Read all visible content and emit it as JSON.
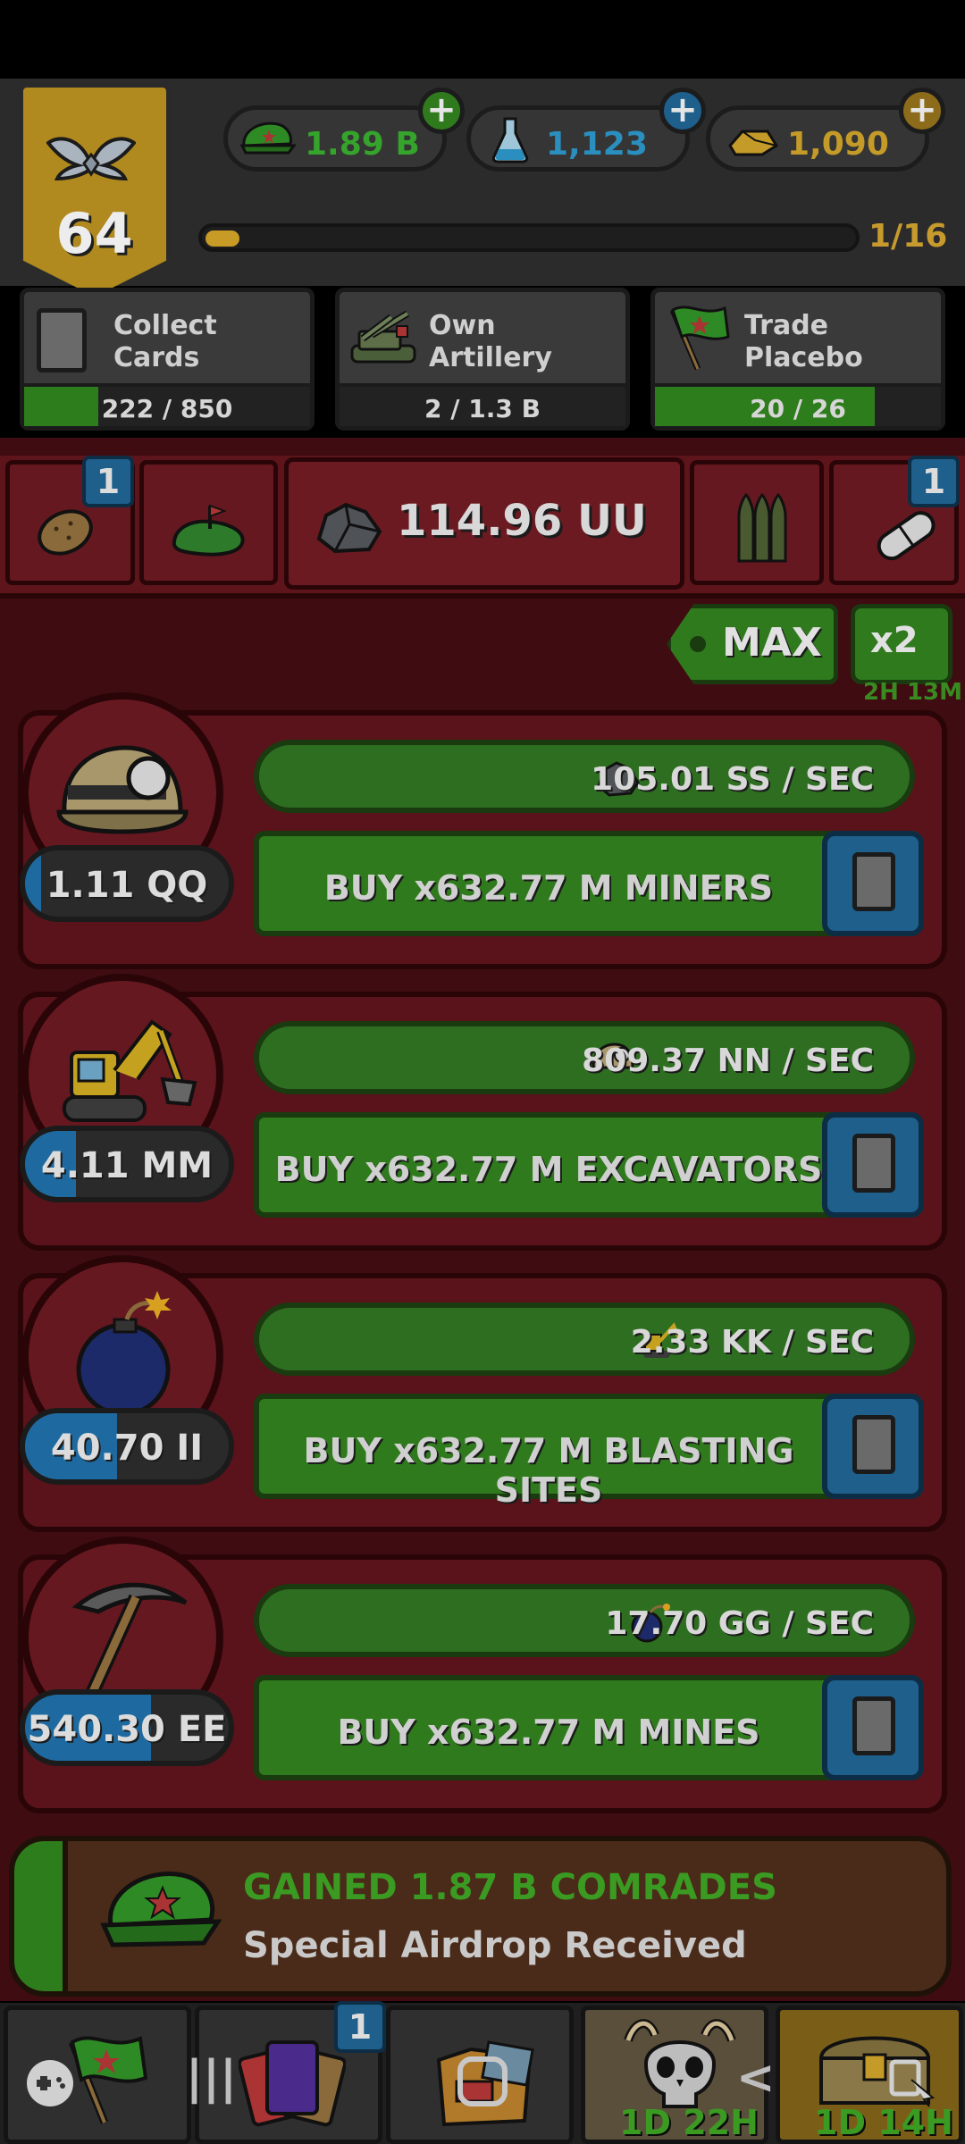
{
  "header": {
    "level": "64",
    "currencies": [
      {
        "name": "comrades",
        "icon": "green-cap-icon",
        "value": "1.89 B",
        "color": "#35a32c"
      },
      {
        "name": "science",
        "icon": "flask-icon",
        "value": "1,123",
        "color": "#2a8fbf"
      },
      {
        "name": "gold",
        "icon": "gold-bars-icon",
        "value": "1,090",
        "color": "#c49a28"
      }
    ],
    "xp": {
      "text": "1/16",
      "progress": 0.0625
    }
  },
  "goals": [
    {
      "title": "Collect Cards",
      "icon": "card-icon",
      "progress_text": "222 / 850",
      "progress": 0.26
    },
    {
      "title": "Own Artillery",
      "icon": "artillery-icon",
      "progress_text": "2 / 1.3 B",
      "progress": 0.0
    },
    {
      "title": "Trade Placebo",
      "icon": "flag-icon",
      "progress_text": "20 / 26",
      "progress": 0.77
    }
  ],
  "tabs": {
    "left": [
      {
        "icon": "potato-icon",
        "badge": "1"
      },
      {
        "icon": "island-icon",
        "badge": ""
      }
    ],
    "active": {
      "icon": "ore-icon",
      "value": "114.96 UU"
    },
    "right": [
      {
        "icon": "bullets-icon",
        "badge": ""
      },
      {
        "icon": "pill-icon",
        "badge": "1"
      }
    ]
  },
  "controls": {
    "max_label": "MAX",
    "multiplier_label": "x2",
    "multiplier_timer": "2H 13M"
  },
  "generators": [
    {
      "name": "miners",
      "icon": "miner-helmet-icon",
      "count": "1.11 QQ",
      "count_fill": 0.08,
      "rate_icon": "ore-icon",
      "rate": "105.01 SS / SEC",
      "buy_label": "BUY x632.77 M MINERS"
    },
    {
      "name": "excavators",
      "icon": "excavator-icon",
      "count": "4.11 MM",
      "count_fill": 0.25,
      "rate_icon": "miner-helmet-icon",
      "rate": "809.37 NN / SEC",
      "buy_label": "BUY x632.77 M EXCAVATORS"
    },
    {
      "name": "blasting-sites",
      "icon": "bomb-icon",
      "count": "40.70 II",
      "count_fill": 0.45,
      "rate_icon": "excavator-icon",
      "rate": "2.33 KK / SEC",
      "buy_label": "BUY x632.77 M BLASTING SITES"
    },
    {
      "name": "mines",
      "icon": "pickaxe-icon",
      "count": "540.30 EE",
      "count_fill": 0.62,
      "rate_icon": "bomb-icon",
      "rate": "17.70 GG / SEC",
      "buy_label": "BUY x632.77 M MINES"
    }
  ],
  "notification": {
    "title": "GAINED 1.87 B COMRADES",
    "subtitle": "Special Airdrop Received",
    "icon": "green-cap-icon"
  },
  "bottom_nav": [
    {
      "icon": "flag-icon",
      "badge": "",
      "timer": ""
    },
    {
      "icon": "cards-icon",
      "badge": "1",
      "timer": ""
    },
    {
      "icon": "folder-icon",
      "badge": "",
      "timer": ""
    },
    {
      "icon": "skull-icon",
      "badge": "",
      "timer": "1D 22H"
    },
    {
      "icon": "chest-icon",
      "badge": "",
      "timer": "1D 14H"
    }
  ]
}
